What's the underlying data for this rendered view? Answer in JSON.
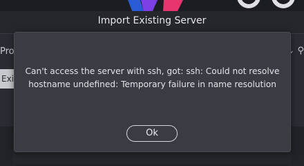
{
  "window": {
    "title": "Import Existing Server"
  },
  "background": {
    "tab_fragment": "Pro",
    "button_fragment": "Exi",
    "toolbar_fragment": "⌄ ⚲"
  },
  "dialog": {
    "message": "Can't access the server with ssh, got: ssh: Could not resolve\nhostname undefined: Temporary failure in name resolution",
    "ok_label": "Ok"
  },
  "colors": {
    "dialog_bg": "#3a3b43",
    "app_bg": "#2b2c33",
    "logo_blue": "#2a5bd7",
    "logo_pink": "#e8356e",
    "logo_purple": "#7b3fe4"
  }
}
